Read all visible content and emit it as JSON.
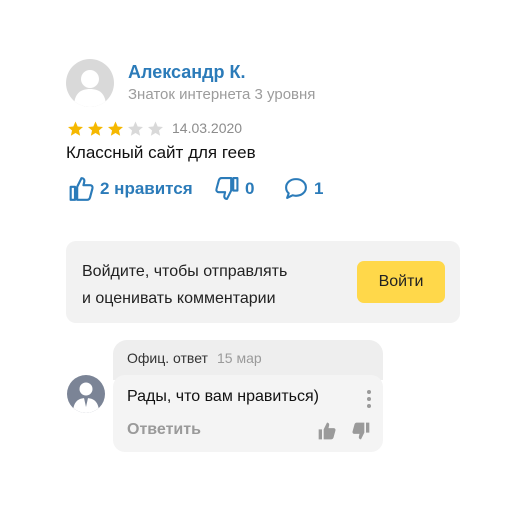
{
  "review": {
    "author_name": "Александр К.",
    "author_level": "Знаток интернета 3 уровня",
    "rating": 3,
    "rating_max": 5,
    "date": "14.03.2020",
    "text": "Классный сайт для геев",
    "likes_label": "2 нравится",
    "dislikes_count": "0",
    "comments_count": "1"
  },
  "login_prompt": {
    "line1": "Войдите, чтобы отправлять",
    "line2": "и оценивать комментарии",
    "button_label": "Войти"
  },
  "official_reply": {
    "label": "Офиц. ответ",
    "date": "15 мар",
    "text": "Рады, что вам нравиться)",
    "answer_label": "Ответить"
  },
  "colors": {
    "accent": "#2b7bb9",
    "star_filled": "#f5b800",
    "star_empty": "#d9d9d9",
    "button_yellow": "#ffd84a"
  }
}
